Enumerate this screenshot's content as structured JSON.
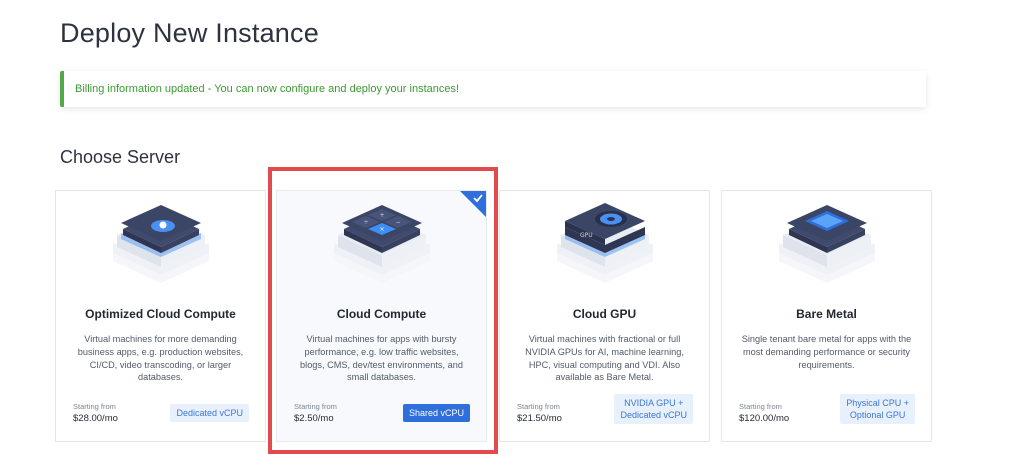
{
  "page": {
    "title": "Deploy New Instance"
  },
  "alert": {
    "message": "Billing information updated - You can now configure and deploy your instances!"
  },
  "section": {
    "title": "Choose Server"
  },
  "cards": [
    {
      "title": "Optimized Cloud Compute",
      "description": "Virtual machines for more demanding business apps, e.g. production websites, CI/CD, video transcoding, or larger databases.",
      "price_label": "Starting from",
      "price": "$28.00/mo",
      "badge_line1": "Dedicated vCPU",
      "badge_line2": "",
      "icon": "optimized-compute-server-icon",
      "selected": false
    },
    {
      "title": "Cloud Compute",
      "description": "Virtual machines for apps with bursty performance, e.g. low traffic websites, blogs, CMS, dev/test environments, and small databases.",
      "price_label": "Starting from",
      "price": "$2.50/mo",
      "badge_line1": "Shared vCPU",
      "badge_line2": "",
      "icon": "cloud-compute-server-icon",
      "selected": true
    },
    {
      "title": "Cloud GPU",
      "description": "Virtual machines with fractional or full NVIDIA GPUs for AI, machine learning, HPC, visual computing and VDI. Also available as Bare Metal.",
      "price_label": "Starting from",
      "price": "$21.50/mo",
      "badge_line1": "NVIDIA GPU +",
      "badge_line2": "Dedicated vCPU",
      "icon": "gpu-server-icon",
      "gpu_label": "GPU",
      "selected": false
    },
    {
      "title": "Bare Metal",
      "description": "Single tenant bare metal for apps with the most demanding performance or security requirements.",
      "price_label": "Starting from",
      "price": "$120.00/mo",
      "badge_line1": "Physical CPU +",
      "badge_line2": "Optional GPU",
      "icon": "bare-metal-server-icon",
      "selected": false
    }
  ],
  "colors": {
    "accent": "#2f6fdc",
    "success": "#55a84a",
    "highlight": "#e34a4e",
    "badge_bg": "#e8f0fb"
  }
}
